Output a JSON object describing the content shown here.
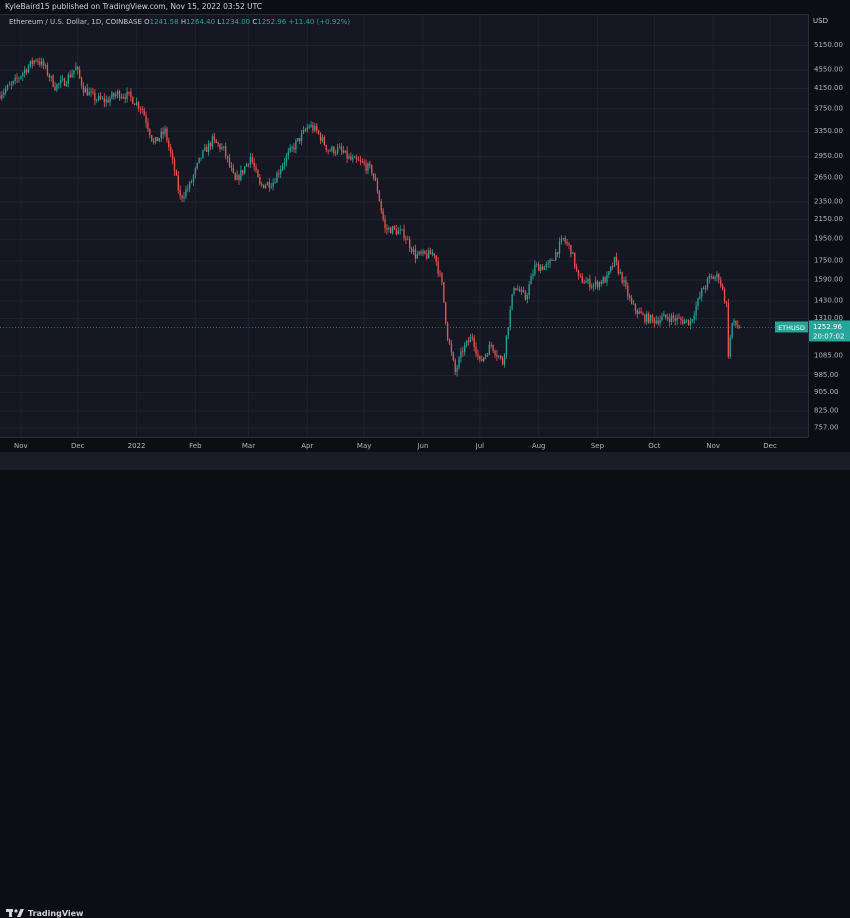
{
  "header": {
    "publisher": "KyleBaird15 published on TradingView.com, Nov 15, 2022 03:52 UTC"
  },
  "symbol": {
    "name": "Ethereum / U.S. Dollar, 1D, COINBASE",
    "o_label": "O",
    "o_value": "1241.58",
    "h_label": "H",
    "h_value": "1264.40",
    "l_label": "L",
    "l_value": "1234.00",
    "c_label": "C",
    "c_value": "1252.96",
    "change": "+11.40 (+0.92%)"
  },
  "price_axis": {
    "currency": "USD",
    "ticker_tag": "ETHUSD",
    "last_price": "1252.96",
    "countdown": "20:07:02"
  },
  "footer": {
    "brand": "TradingView"
  },
  "colors": {
    "up": "#26a69a",
    "down": "#ef5350",
    "background": "#151822",
    "grid": "#1f2330",
    "price_line": "#26a69a"
  },
  "chart_data": {
    "type": "candlestick",
    "symbol": "ETHUSD",
    "interval": "1D",
    "log_scale": true,
    "ylim": [
      720,
      6000
    ],
    "yticks": [
      5150,
      4550,
      4150,
      3750,
      3350,
      2950,
      2650,
      2350,
      2150,
      1950,
      1750,
      1590,
      1430,
      1310,
      1085,
      985,
      905,
      825,
      757
    ],
    "ytick_labels": [
      "5150.00",
      "4550.00",
      "4150.00",
      "3750.00",
      "3350.00",
      "2950.00",
      "2650.00",
      "2350.00",
      "2150.00",
      "1950.00",
      "1750.00",
      "1590.00",
      "1430.00",
      "1310.00",
      "1085.00",
      "985.00",
      "905.00",
      "825.00",
      "757.00"
    ],
    "xticks": [
      "Nov",
      "Dec",
      "2022",
      "Feb",
      "Mar",
      "Apr",
      "May",
      "Jun",
      "Jul",
      "Aug",
      "Sep",
      "Oct",
      "Nov",
      "Dec"
    ],
    "xtick_dates": [
      "2021-11-01",
      "2021-12-01",
      "2022-01-01",
      "2022-02-01",
      "2022-03-01",
      "2022-04-01",
      "2022-05-01",
      "2022-06-01",
      "2022-07-01",
      "2022-08-01",
      "2022-09-01",
      "2022-10-01",
      "2022-11-01",
      "2022-12-01"
    ],
    "x_range": [
      "2021-10-21",
      "2022-12-21"
    ],
    "last_close": 1252.96,
    "approx_close_path": [
      [
        "2021-10-21",
        4050
      ],
      [
        "2021-10-28",
        4250
      ],
      [
        "2021-11-03",
        4550
      ],
      [
        "2021-11-09",
        4820
      ],
      [
        "2021-11-13",
        4650
      ],
      [
        "2021-11-19",
        4200
      ],
      [
        "2021-11-24",
        4300
      ],
      [
        "2021-11-30",
        4600
      ],
      [
        "2021-12-04",
        4150
      ],
      [
        "2021-12-10",
        3950
      ],
      [
        "2021-12-16",
        3900
      ],
      [
        "2021-12-22",
        4050
      ],
      [
        "2021-12-28",
        4000
      ],
      [
        "2022-01-04",
        3750
      ],
      [
        "2022-01-10",
        3150
      ],
      [
        "2022-01-16",
        3350
      ],
      [
        "2022-01-21",
        2750
      ],
      [
        "2022-01-24",
        2400
      ],
      [
        "2022-01-29",
        2550
      ],
      [
        "2022-02-04",
        2950
      ],
      [
        "2022-02-10",
        3200
      ],
      [
        "2022-02-16",
        3050
      ],
      [
        "2022-02-22",
        2600
      ],
      [
        "2022-02-26",
        2750
      ],
      [
        "2022-03-02",
        2950
      ],
      [
        "2022-03-07",
        2550
      ],
      [
        "2022-03-14",
        2600
      ],
      [
        "2022-03-20",
        2900
      ],
      [
        "2022-03-26",
        3150
      ],
      [
        "2022-04-02",
        3450
      ],
      [
        "2022-04-06",
        3350
      ],
      [
        "2022-04-12",
        3050
      ],
      [
        "2022-04-18",
        3050
      ],
      [
        "2022-04-24",
        2900
      ],
      [
        "2022-04-30",
        2850
      ],
      [
        "2022-05-05",
        2750
      ],
      [
        "2022-05-08",
        2500
      ],
      [
        "2022-05-12",
        2050
      ],
      [
        "2022-05-16",
        2050
      ],
      [
        "2022-05-22",
        2000
      ],
      [
        "2022-05-28",
        1800
      ],
      [
        "2022-06-03",
        1800
      ],
      [
        "2022-06-07",
        1820
      ],
      [
        "2022-06-11",
        1550
      ],
      [
        "2022-06-14",
        1200
      ],
      [
        "2022-06-18",
        1000
      ],
      [
        "2022-06-22",
        1120
      ],
      [
        "2022-06-27",
        1200
      ],
      [
        "2022-07-01",
        1050
      ],
      [
        "2022-07-07",
        1150
      ],
      [
        "2022-07-13",
        1050
      ],
      [
        "2022-07-19",
        1550
      ],
      [
        "2022-07-25",
        1450
      ],
      [
        "2022-07-30",
        1700
      ],
      [
        "2022-08-06",
        1700
      ],
      [
        "2022-08-14",
        1950
      ],
      [
        "2022-08-18",
        1850
      ],
      [
        "2022-08-22",
        1600
      ],
      [
        "2022-08-30",
        1550
      ],
      [
        "2022-09-06",
        1600
      ],
      [
        "2022-09-10",
        1750
      ],
      [
        "2022-09-14",
        1600
      ],
      [
        "2022-09-19",
        1400
      ],
      [
        "2022-09-25",
        1320
      ],
      [
        "2022-10-01",
        1300
      ],
      [
        "2022-10-08",
        1320
      ],
      [
        "2022-10-14",
        1300
      ],
      [
        "2022-10-20",
        1290
      ],
      [
        "2022-10-26",
        1500
      ],
      [
        "2022-10-30",
        1600
      ],
      [
        "2022-11-04",
        1620
      ],
      [
        "2022-11-08",
        1400
      ],
      [
        "2022-11-09",
        1100
      ],
      [
        "2022-11-11",
        1280
      ],
      [
        "2022-11-15",
        1253
      ]
    ]
  }
}
